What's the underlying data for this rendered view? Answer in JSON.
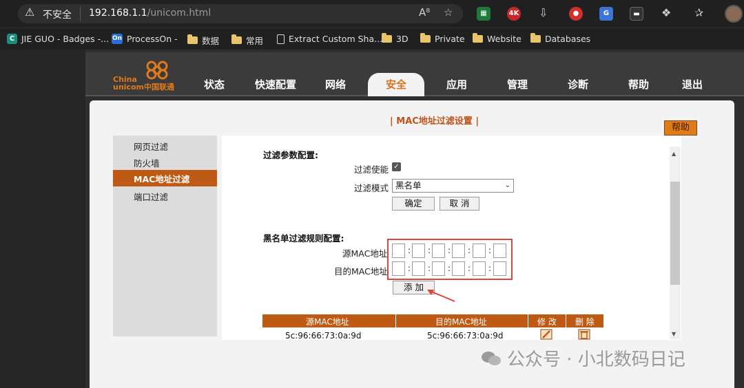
{
  "browser": {
    "insecure_label": "不安全",
    "url_host": "192.168.1.1",
    "url_path": "/unicom.html",
    "ext_4k": "4K"
  },
  "bookmarks": [
    {
      "label": "JIE GUO - Badges -..."
    },
    {
      "label": "ProcessOn -"
    },
    {
      "label": "数据"
    },
    {
      "label": "常用"
    },
    {
      "label": "Extract Custom Sha..."
    },
    {
      "label": "3D"
    },
    {
      "label": "Private"
    },
    {
      "label": "Website"
    },
    {
      "label": "Databases"
    }
  ],
  "logo": {
    "line1": "China",
    "line2": "unicom中国联通"
  },
  "nav": {
    "items": [
      "状态",
      "快速配置",
      "网络",
      "安全",
      "应用",
      "管理",
      "诊断",
      "帮助",
      "退出"
    ],
    "active": "安全"
  },
  "page_title": "| MAC地址过滤设置 |",
  "help_button": "帮助",
  "sidebar": {
    "items": [
      "网页过滤",
      "防火墙",
      "MAC地址过滤",
      "端口过滤"
    ],
    "active": "MAC地址过滤"
  },
  "filter_params": {
    "title": "过滤参数配置:",
    "enable_label": "过滤使能",
    "enabled": true,
    "mode_label": "过滤模式",
    "mode_value": "黑名单",
    "confirm": "确定",
    "cancel": "取 消"
  },
  "blacklist": {
    "title": "黑名单过滤规则配置:",
    "src_label": "源MAC地址",
    "dst_label": "目的MAC地址",
    "add": "添 加"
  },
  "table": {
    "headers": [
      "源MAC地址",
      "目的MAC地址",
      "修 改",
      "删 除"
    ],
    "rows": [
      {
        "src": "5c:96:66:73:0a:9d",
        "dst": "5c:96:66:73:0a:9d"
      }
    ]
  },
  "watermark": "公众号 · 小北数码日记",
  "colors": {
    "accent": "#bf5a14",
    "help": "#e07b1a",
    "highlight_box": "#e0443e"
  }
}
